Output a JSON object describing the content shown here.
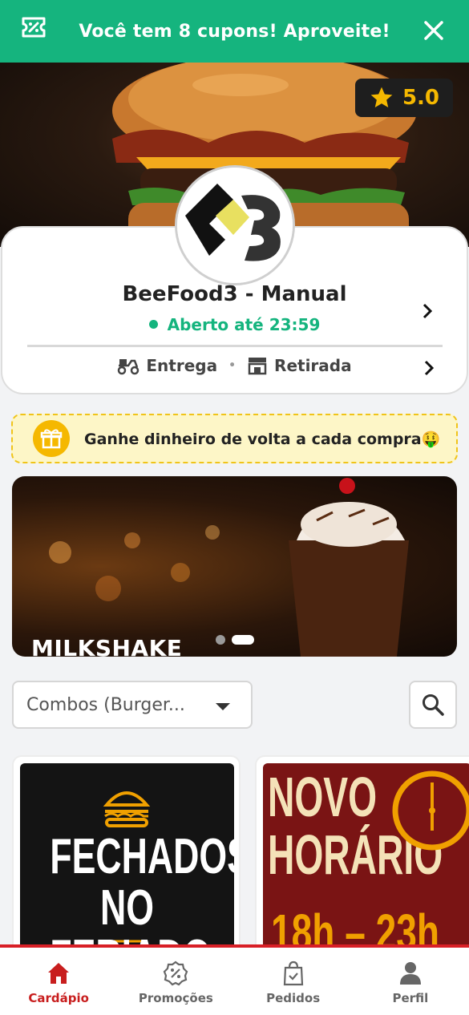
{
  "coupon_banner": {
    "text": "Você tem 8 cupons! Aproveite!",
    "icon": "ticket-percent-icon",
    "close_icon": "close-icon"
  },
  "rating": {
    "value": "5.0",
    "icon": "star-icon"
  },
  "store": {
    "name": "BeeFood3 - Manual",
    "status": "Aberto até 23:59",
    "delivery_label": "Entrega",
    "pickup_label": "Retirada"
  },
  "cashback": {
    "text": "Ganhe dinheiro de volta a cada compra🤑",
    "icon": "gift-icon"
  },
  "carousel": {
    "slide_label": "MILKSHAKE",
    "slide_count": 2,
    "active_index": 1
  },
  "category_select": {
    "value": "Combos (Burger..."
  },
  "products": [
    {
      "lines": [
        "FECHADOS",
        "NO FERIADO"
      ]
    },
    {
      "lines": [
        "NOVO",
        "HORÁRIO",
        "18h – 23h"
      ]
    }
  ],
  "bottom_nav": [
    {
      "label": "Cardápio",
      "icon": "home-icon",
      "active": true
    },
    {
      "label": "Promoções",
      "icon": "discount-badge-icon",
      "active": false
    },
    {
      "label": "Pedidos",
      "icon": "shopping-bag-icon",
      "active": false
    },
    {
      "label": "Perfil",
      "icon": "user-icon",
      "active": false
    }
  ],
  "colors": {
    "primary_green": "#15b47e",
    "accent_red": "#c81e1e",
    "star": "#f5b800"
  }
}
